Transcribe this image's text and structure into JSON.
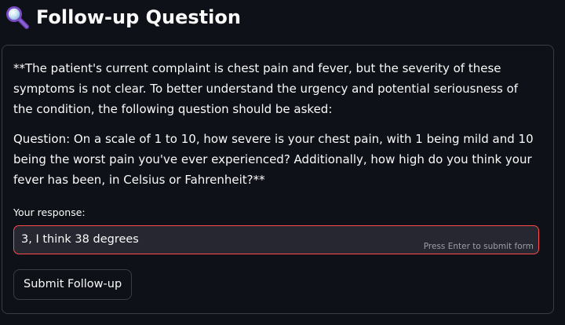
{
  "header": {
    "icon": "magnifying-glass-icon",
    "title": "Follow-up Question"
  },
  "card": {
    "paragraph_1": "**The patient's current complaint is chest pain and fever, but the severity of these symptoms is not clear. To better understand the urgency and potential seriousness of the condition, the following question should be asked:",
    "paragraph_2": "Question: On a scale of 1 to 10, how severe is your chest pain, with 1 being mild and 10 being the worst pain you've ever experienced? Additionally, how high do you think your fever has been, in Celsius or Fahrenheit?**",
    "response_label": "Your response:",
    "response_value": "3, I think 38 degrees",
    "input_hint": "Press Enter to submit form",
    "submit_label": "Submit Follow-up"
  },
  "colors": {
    "background": "#0e1117",
    "input_background": "#262730",
    "focus_border": "#ff4b4b",
    "border": "#3a3d47",
    "text": "#fafafa",
    "hint_text": "#9c9ea6"
  }
}
